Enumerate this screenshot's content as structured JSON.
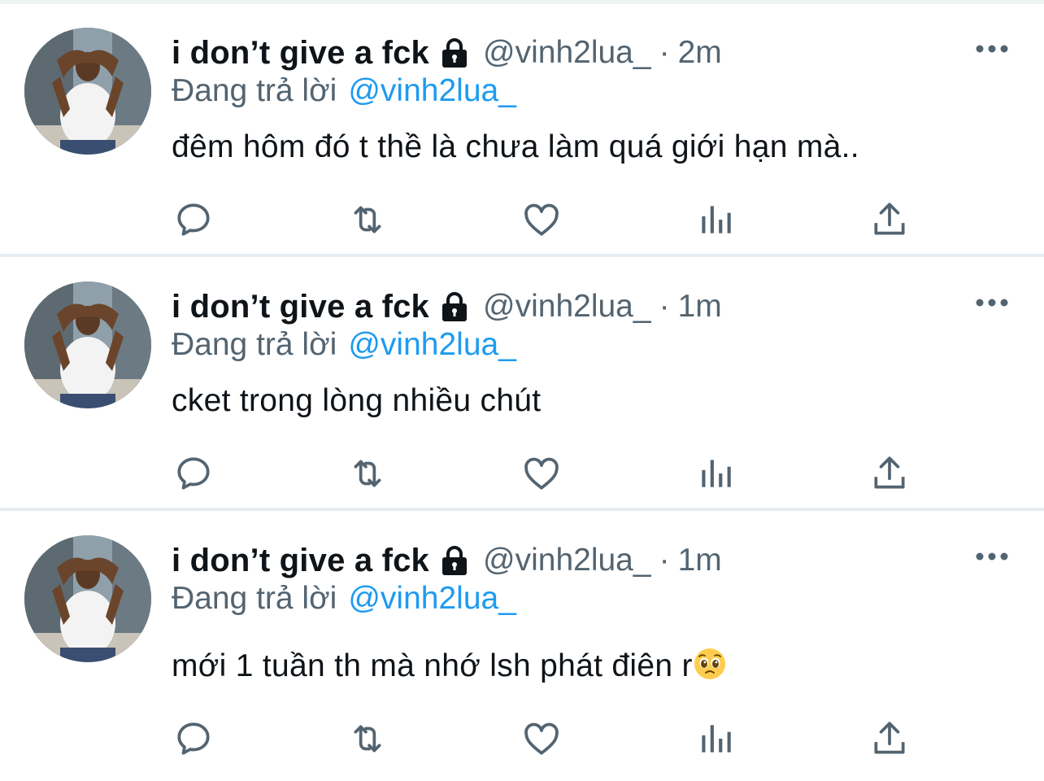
{
  "colors": {
    "text_primary": "#0f1419",
    "text_secondary": "#536471",
    "link_blue": "#1d9bf0",
    "divider": "#e6ecf0",
    "icon_gray": "#536471"
  },
  "icons": {
    "lock": "lock-icon",
    "more": "more-icon",
    "reply": "reply-icon",
    "retweet": "retweet-icon",
    "like": "heart-icon",
    "analytics": "analytics-icon",
    "share": "share-icon",
    "emoji": "pleading-face-emoji"
  },
  "tweets": [
    {
      "display_name": "i don’t give a fck",
      "handle": "@vinh2lua_",
      "separator": "·",
      "time": "2m",
      "reply_label": "Đang trả lời",
      "reply_handle": "@vinh2lua_",
      "text": "đêm hôm đó t thề là chưa làm quá giới hạn mà.."
    },
    {
      "display_name": "i don’t give a fck",
      "handle": "@vinh2lua_",
      "separator": "·",
      "time": "1m",
      "reply_label": "Đang trả lời",
      "reply_handle": "@vinh2lua_",
      "text": "cket trong lòng nhiều chút"
    },
    {
      "display_name": "i don’t give a fck",
      "handle": "@vinh2lua_",
      "separator": "·",
      "time": "1m",
      "reply_label": "Đang trả lời",
      "reply_handle": "@vinh2lua_",
      "text": "mới 1 tuần th mà nhớ lsh phát điên r",
      "trailing_emoji": "pleading-face"
    }
  ]
}
